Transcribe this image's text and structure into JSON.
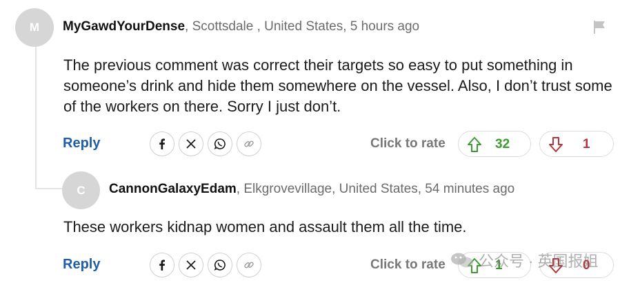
{
  "colors": {
    "link": "#1e5ea8",
    "upvote": "#3d9a33",
    "downvote": "#b5333a",
    "avatar_bg": "#d6d6d6"
  },
  "comments": [
    {
      "avatar_letter": "M",
      "username": "MyGawdYourDense",
      "location_time": ", Scottsdale , United States, 5 hours ago",
      "body": "The previous comment was correct their targets so easy to put something in someone’s drink and hide them somewhere on the vessel. Also, I don’t trust some of the workers on there. Sorry I just don’t.",
      "reply_label": "Reply",
      "click_to_rate": "Click to rate",
      "upvotes": "32",
      "downvotes": "1",
      "icons": [
        "facebook-icon",
        "x-icon",
        "whatsapp-icon",
        "link-icon",
        "flag-icon",
        "thumbs-up-arrow-icon",
        "thumbs-down-arrow-icon"
      ]
    },
    {
      "avatar_letter": "C",
      "username": "CannonGalaxyEdam",
      "location_time": ", Elkgrovevillage, United States, 54 minutes ago",
      "body": "These workers kidnap women and assault them all the time.",
      "reply_label": "Reply",
      "click_to_rate": "Click to rate",
      "upvotes": "1",
      "downvotes": "0",
      "icons": [
        "facebook-icon",
        "x-icon",
        "whatsapp-icon",
        "link-icon",
        "thumbs-up-arrow-icon",
        "thumbs-down-arrow-icon"
      ]
    }
  ],
  "watermark": {
    "text": "公众号 · 英国报姐",
    "icon": "wechat-icon"
  }
}
